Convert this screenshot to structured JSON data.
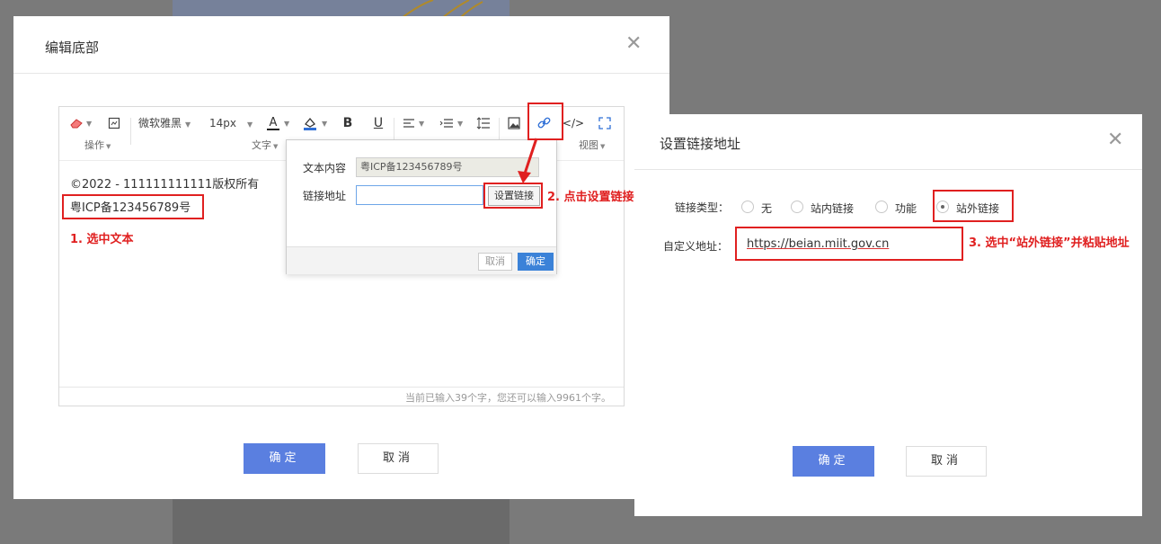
{
  "dialog_edit_footer": {
    "title": "编辑底部",
    "toolbar": {
      "font_family": "微软雅黑",
      "font_size": "14px",
      "bold": "B",
      "underline": "U",
      "font_color_letter": "A",
      "group_operate": "操作",
      "group_text": "文字",
      "group_view": "视图",
      "code_icon": "</>"
    },
    "content": {
      "line1": "©2022 - 111111111111版权所有",
      "line2": "粤ICP备123456789号"
    },
    "status": "当前已输入39个字，您还可以输入9961个字。",
    "link_popup": {
      "text_label": "文本内容",
      "text_value": "粤ICP备123456789号",
      "url_label": "链接地址",
      "url_value": "",
      "set_link_button": "设置链接",
      "cancel": "取消",
      "ok": "确定"
    },
    "confirm": "确定",
    "cancel": "取消"
  },
  "dialog_set_link": {
    "title": "设置链接地址",
    "link_type_label": "链接类型：",
    "options": [
      "无",
      "站内链接",
      "功能",
      "站外链接"
    ],
    "selected_option": "站外链接",
    "custom_url_label": "自定义地址：",
    "custom_url_value": "https://beian.miit.gov.cn",
    "confirm": "确定",
    "cancel": "取消"
  },
  "annotations": {
    "step1": "1. 选中文本",
    "step2": "2. 点击设置链接",
    "step3": "3. 选中“站外链接”并粘贴地址"
  },
  "colors": {
    "annotation_red": "#e02020",
    "primary_button": "#5a7fe0",
    "overlay": "#7a7a7a"
  }
}
